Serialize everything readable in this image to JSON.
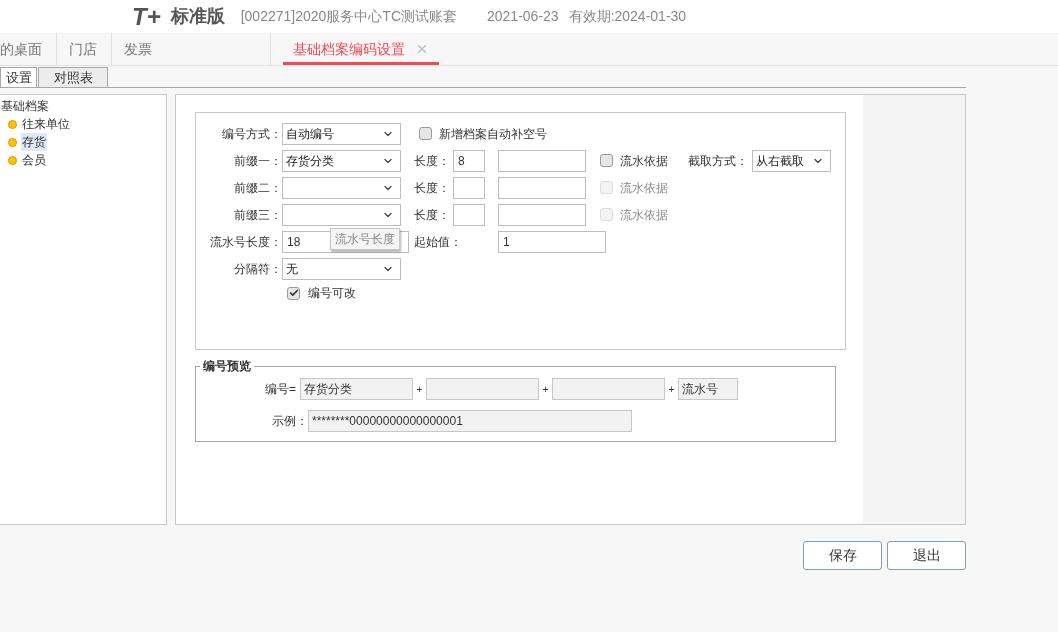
{
  "header": {
    "logo": "T+",
    "edition": "标准版",
    "account": "[002271]2020服务中心TC测试账套",
    "date": "2021-06-23",
    "validity": "有效期:2024-01-30"
  },
  "tabs": [
    {
      "label": "的桌面",
      "selected": false
    },
    {
      "label": "门店",
      "selected": false
    },
    {
      "label": "发票",
      "selected": false
    },
    {
      "label": "基础档案编码设置",
      "selected": true
    }
  ],
  "subtabs": [
    {
      "label": "设置",
      "selected": true
    },
    {
      "label": "对照表",
      "selected": false
    }
  ],
  "tree": {
    "label": "基础档案",
    "children": [
      {
        "label": "往来单位",
        "selected": false
      },
      {
        "label": "存货",
        "selected": true
      },
      {
        "label": "会员",
        "selected": false
      }
    ]
  },
  "form": {
    "method": {
      "label": "编号方式：",
      "value": "自动编号"
    },
    "autofill": {
      "label": "新增档案自动补空号",
      "checked": false
    },
    "prefixes": [
      {
        "label": "前缀一：",
        "value": "存货分类",
        "length_label": "长度：",
        "length": "8",
        "serial": {
          "label": "流水依据",
          "checked": false,
          "disabled": false
        },
        "cut": {
          "label": "截取方式：",
          "value": "从右截取"
        }
      },
      {
        "label": "前缀二：",
        "length_label": "长度：",
        "serial": {
          "label": "流水依据",
          "checked": false,
          "disabled": true
        }
      },
      {
        "label": "前缀三：",
        "length_label": "长度：",
        "serial": {
          "label": "流水依据",
          "checked": false,
          "disabled": true
        }
      }
    ],
    "serial_length": {
      "label": "流水号长度：",
      "value": "18",
      "tooltip": "流水号长度"
    },
    "start": {
      "label": "起始值：",
      "value": "1"
    },
    "separator": {
      "label": "分隔符：",
      "value": "无"
    },
    "editable": {
      "label": "编号可改",
      "checked": true
    }
  },
  "preview": {
    "title": "编号预览",
    "code_label": "编号=",
    "parts": [
      {
        "kind": "prefix",
        "value": "存货分类"
      },
      {
        "kind": "prefix"
      },
      {
        "kind": "prefix"
      },
      {
        "kind": "serial",
        "value": "流水号"
      }
    ],
    "plus": "+",
    "example_label": "示例：",
    "example": "********00000000000000001"
  },
  "buttons": [
    "保存",
    "退出"
  ]
}
